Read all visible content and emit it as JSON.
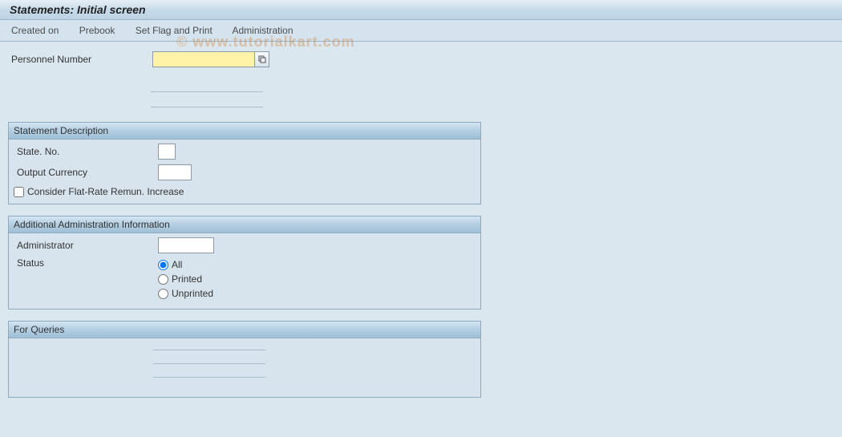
{
  "header": {
    "title": "Statements: Initial screen"
  },
  "menu": {
    "created_on": "Created on",
    "prebook": "Prebook",
    "set_flag_print": "Set Flag and Print",
    "administration": "Administration"
  },
  "personnel": {
    "label": "Personnel Number",
    "value": "",
    "f4_icon": "search-help"
  },
  "group_statement": {
    "title": "Statement Description",
    "state_no_label": "State. No.",
    "state_no_value": "",
    "output_currency_label": "Output Currency",
    "output_currency_value": "",
    "flat_rate_label": "Consider Flat-Rate Remun. Increase",
    "flat_rate_checked": false
  },
  "group_admin": {
    "title": "Additional Administration Information",
    "administrator_label": "Administrator",
    "administrator_value": "",
    "status_label": "Status",
    "status_options": {
      "all": "All",
      "printed": "Printed",
      "unprinted": "Unprinted"
    },
    "status_selected": "all"
  },
  "group_queries": {
    "title": "For Queries"
  },
  "watermark": "© www.tutorialkart.com"
}
